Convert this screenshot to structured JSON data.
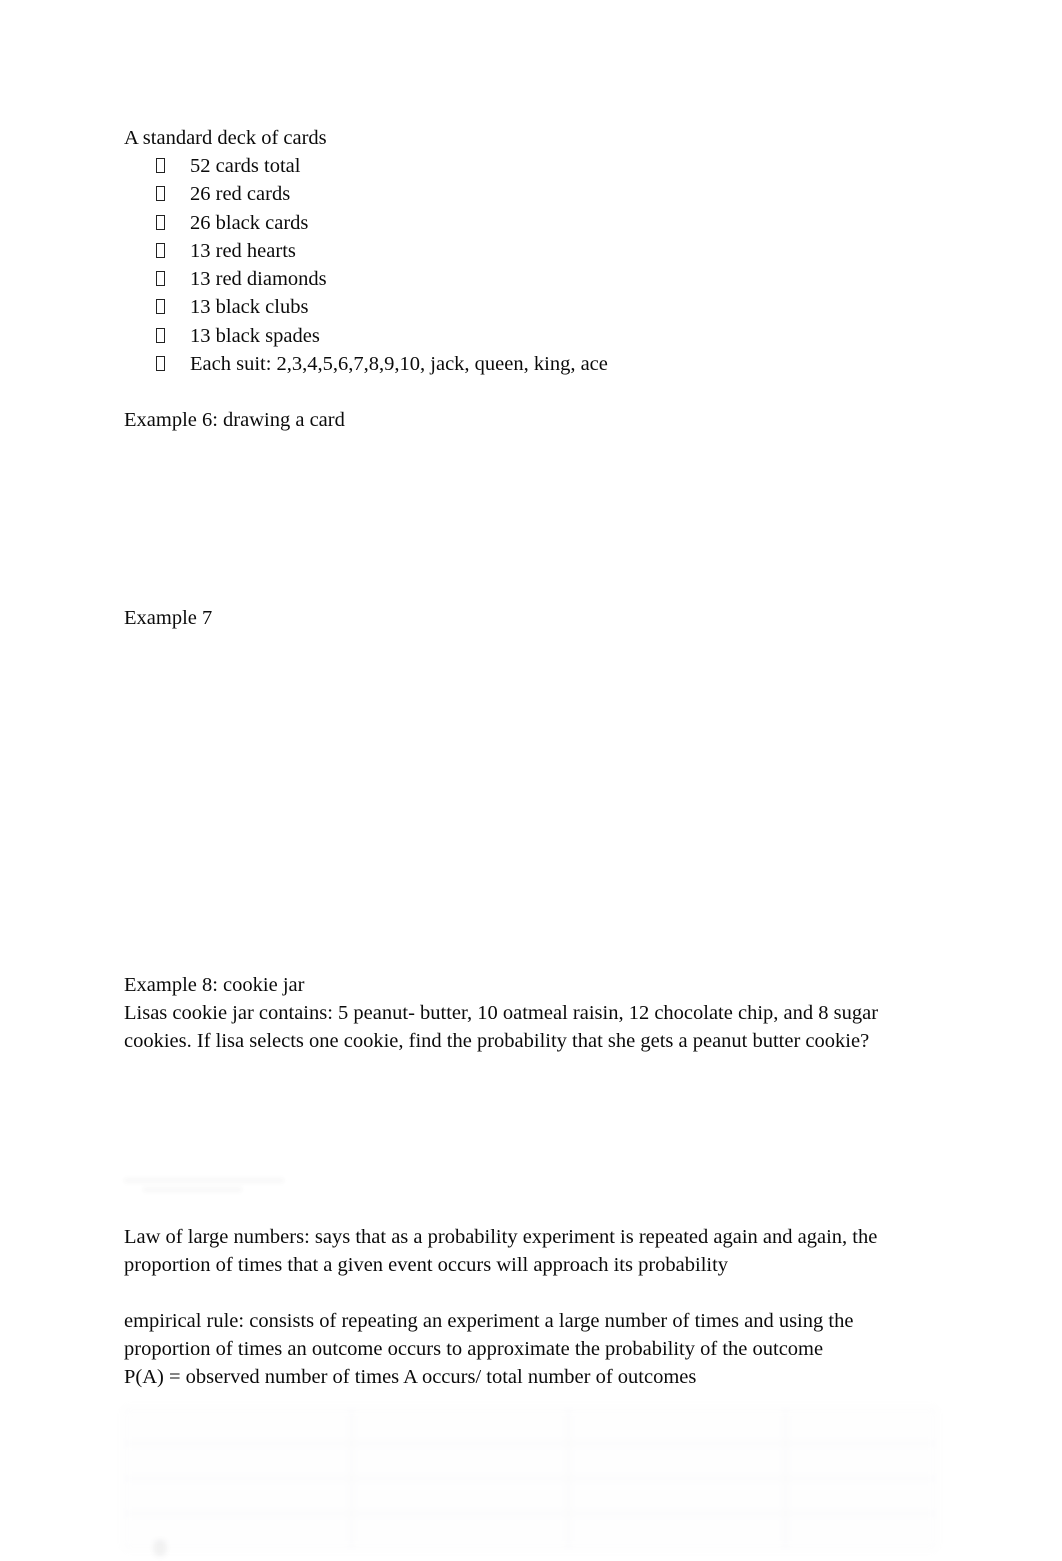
{
  "document": {
    "background_color": "#ffffff",
    "text_color": "#0b0b0b"
  },
  "section_cards": {
    "heading": "A standard deck of cards",
    "bullet_glyph": "missing-glyph-box",
    "items": [
      "52 cards total",
      "26 red cards",
      "26 black cards",
      "13 red hearts",
      "13 red diamonds",
      "13 black clubs",
      "13 black spades",
      "Each suit: 2,3,4,5,6,7,8,9,10, jack, queen, king, ace"
    ]
  },
  "example6": {
    "heading": "Example 6: drawing a card"
  },
  "example7": {
    "heading": "Example 7"
  },
  "example8": {
    "heading": "Example 8: cookie jar",
    "body_line1": "Lisas cookie jar contains: 5 peanut- butter, 10 oatmeal raisin, 12 chocolate chip, and 8 sugar",
    "body_line2": "cookies. If lisa selects one cookie, find the probability that she gets a peanut butter cookie?"
  },
  "law_of_large_numbers": {
    "line1": "Law of large numbers: says that as a probability experiment is repeated again and again, the",
    "line2": "proportion of times that a given event occurs will approach its probability"
  },
  "empirical_rule": {
    "line1": "empirical rule: consists of repeating an experiment a large number of times and using the",
    "line2": "proportion of times an outcome occurs to approximate the probability of the outcome",
    "line3": "P(A) = observed number of times A occurs/ total number of outcomes"
  },
  "faded_table": {
    "caption": "",
    "rows": [
      [
        "",
        "",
        "",
        ""
      ],
      [
        "",
        "",
        "",
        ""
      ],
      [
        "",
        "",
        "",
        ""
      ],
      [
        "",
        "",
        "",
        ""
      ]
    ],
    "footnote": ""
  }
}
